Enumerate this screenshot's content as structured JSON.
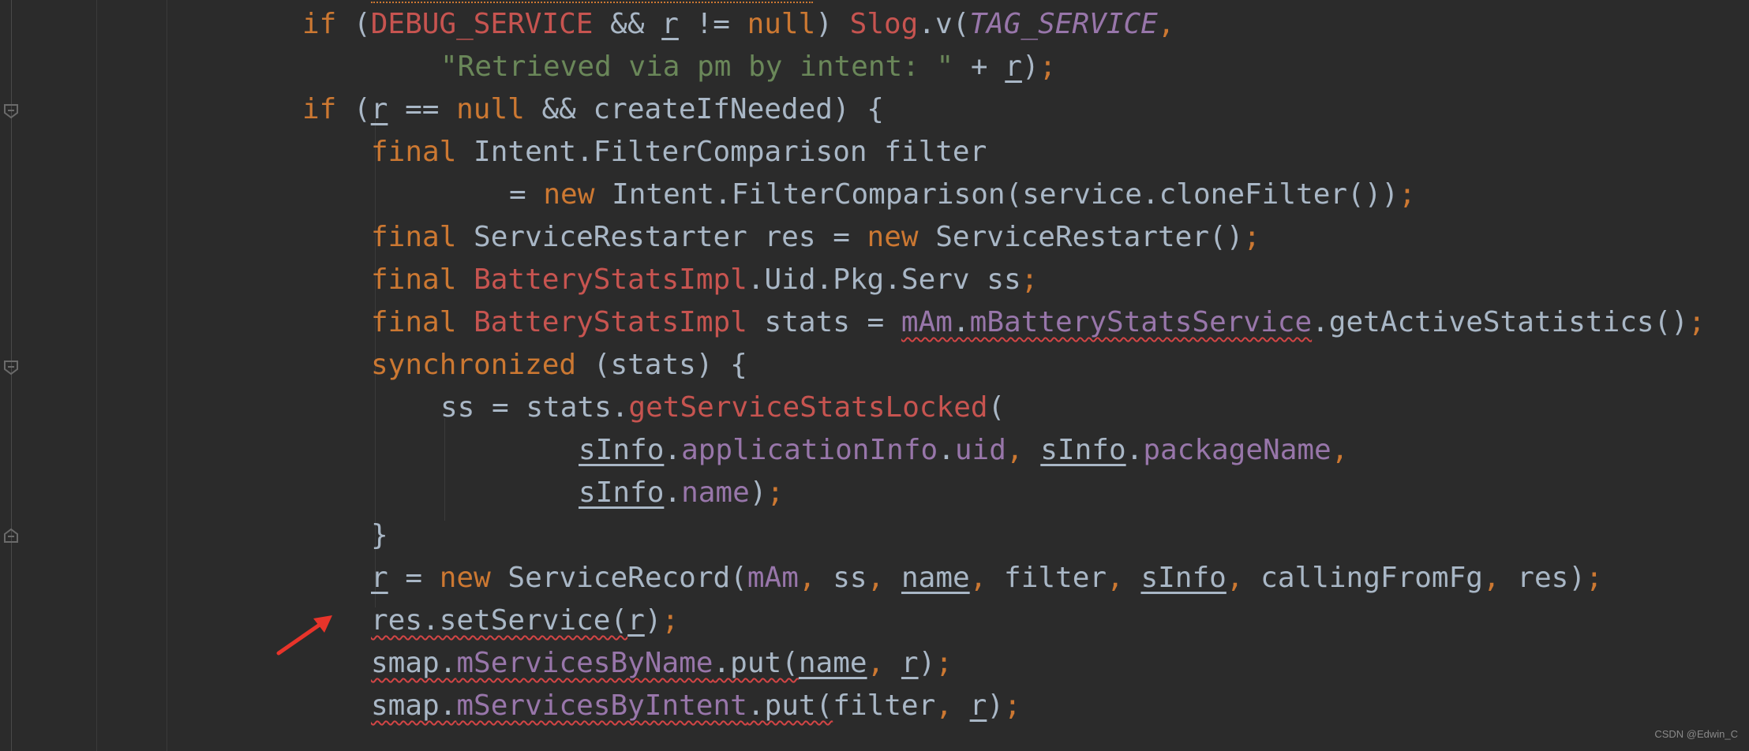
{
  "colors": {
    "background": "#2b2b2b",
    "keyword": "#cc7832",
    "constant": "#c75450",
    "field": "#9876aa",
    "string": "#6a8759",
    "text": "#a9b7c6",
    "error_underline": "#d24545",
    "arrow": "#e8342a"
  },
  "code": {
    "lines": [
      [
        {
          "t": "if",
          "c": "kw"
        },
        {
          "t": " ("
        },
        {
          "t": "DEBUG_SERVICE",
          "c": "const"
        },
        {
          "t": " && "
        },
        {
          "t": "r",
          "c": "ul"
        },
        {
          "t": " != "
        },
        {
          "t": "null",
          "c": "kw"
        },
        {
          "t": ") "
        },
        {
          "t": "Slog",
          "c": "const"
        },
        {
          "t": ".v("
        },
        {
          "t": "TAG_SERVICE",
          "c": "ital-purple"
        },
        {
          "t": ",",
          "c": "kw"
        }
      ],
      [
        {
          "t": "\"Retrieved via pm by intent: \"",
          "c": "str"
        },
        {
          "t": " + "
        },
        {
          "t": "r",
          "c": "ul"
        },
        {
          "t": ")"
        },
        {
          "t": ";",
          "c": "kw"
        }
      ],
      [
        {
          "t": "if",
          "c": "kw"
        },
        {
          "t": " ("
        },
        {
          "t": "r",
          "c": "ul"
        },
        {
          "t": " == "
        },
        {
          "t": "null",
          "c": "kw"
        },
        {
          "t": " && createIfNeeded) {"
        }
      ],
      [
        {
          "t": "final",
          "c": "kw"
        },
        {
          "t": " Intent.FilterComparison filter"
        }
      ],
      [
        {
          "t": "= "
        },
        {
          "t": "new",
          "c": "kw"
        },
        {
          "t": " Intent.FilterComparison(service.cloneFilter())"
        },
        {
          "t": ";",
          "c": "kw"
        }
      ],
      [
        {
          "t": "final",
          "c": "kw"
        },
        {
          "t": " ServiceRestarter res = "
        },
        {
          "t": "new",
          "c": "kw"
        },
        {
          "t": " ServiceRestarter()"
        },
        {
          "t": ";",
          "c": "kw"
        }
      ],
      [
        {
          "t": "final",
          "c": "kw"
        },
        {
          "t": " "
        },
        {
          "t": "BatteryStatsImpl",
          "c": "const"
        },
        {
          "t": ".Uid.Pkg.Serv ss"
        },
        {
          "t": ";",
          "c": "kw"
        }
      ],
      [
        {
          "t": "final",
          "c": "kw"
        },
        {
          "t": " "
        },
        {
          "t": "BatteryStatsImpl",
          "c": "const"
        },
        {
          "t": " stats = "
        },
        {
          "t": "mAm",
          "c": "purple err"
        },
        {
          "t": ".",
          "c": "err"
        },
        {
          "t": "mBatteryStatsService",
          "c": "purple err"
        },
        {
          "t": ".getActiveStatistics()"
        },
        {
          "t": ";",
          "c": "kw"
        }
      ],
      [
        {
          "t": "synchronized",
          "c": "kw"
        },
        {
          "t": " (stats) {"
        }
      ],
      [
        {
          "t": "ss = stats."
        },
        {
          "t": "getServiceStatsLocked",
          "c": "const"
        },
        {
          "t": "("
        }
      ],
      [
        {
          "t": "sInfo",
          "c": "ul"
        },
        {
          "t": "."
        },
        {
          "t": "applicationInfo",
          "c": "purple"
        },
        {
          "t": "."
        },
        {
          "t": "uid",
          "c": "purple"
        },
        {
          "t": ", ",
          "c": "kw"
        },
        {
          "t": "sInfo",
          "c": "ul"
        },
        {
          "t": "."
        },
        {
          "t": "packageName",
          "c": "purple"
        },
        {
          "t": ",",
          "c": "kw"
        }
      ],
      [
        {
          "t": "sInfo",
          "c": "ul"
        },
        {
          "t": "."
        },
        {
          "t": "name",
          "c": "purple"
        },
        {
          "t": ")"
        },
        {
          "t": ";",
          "c": "kw"
        }
      ],
      [
        {
          "t": "}"
        }
      ],
      [
        {
          "t": "r",
          "c": "ul"
        },
        {
          "t": " = "
        },
        {
          "t": "new",
          "c": "kw"
        },
        {
          "t": " ServiceRecord("
        },
        {
          "t": "mAm",
          "c": "purple"
        },
        {
          "t": ", ",
          "c": "kw"
        },
        {
          "t": "ss"
        },
        {
          "t": ", ",
          "c": "kw"
        },
        {
          "t": "name",
          "c": "ul"
        },
        {
          "t": ", ",
          "c": "kw"
        },
        {
          "t": "filter"
        },
        {
          "t": ", ",
          "c": "kw"
        },
        {
          "t": "sInfo",
          "c": "ul"
        },
        {
          "t": ", ",
          "c": "kw"
        },
        {
          "t": "callingFromFg"
        },
        {
          "t": ", ",
          "c": "kw"
        },
        {
          "t": "res)"
        },
        {
          "t": ";",
          "c": "kw"
        }
      ],
      [
        {
          "t": "res.setService(",
          "c": "err"
        },
        {
          "t": "r",
          "c": "ul"
        },
        {
          "t": ")"
        },
        {
          "t": ";",
          "c": "kw"
        }
      ],
      [
        {
          "t": "smap.",
          "c": "err"
        },
        {
          "t": "mServicesByName",
          "c": "purple err"
        },
        {
          "t": ".put(",
          "c": "err"
        },
        {
          "t": "name",
          "c": "ul"
        },
        {
          "t": ", ",
          "c": "kw"
        },
        {
          "t": "r",
          "c": "ul"
        },
        {
          "t": ")"
        },
        {
          "t": ";",
          "c": "kw"
        }
      ],
      [
        {
          "t": "smap.",
          "c": "err"
        },
        {
          "t": "mServicesByIntent",
          "c": "purple err"
        },
        {
          "t": ".put(",
          "c": "err"
        },
        {
          "t": "filter"
        },
        {
          "t": ", ",
          "c": "kw"
        },
        {
          "t": "r",
          "c": "ul"
        },
        {
          "t": ")"
        },
        {
          "t": ";",
          "c": "kw"
        }
      ]
    ]
  },
  "watermark": "CSDN @Edwin_C"
}
